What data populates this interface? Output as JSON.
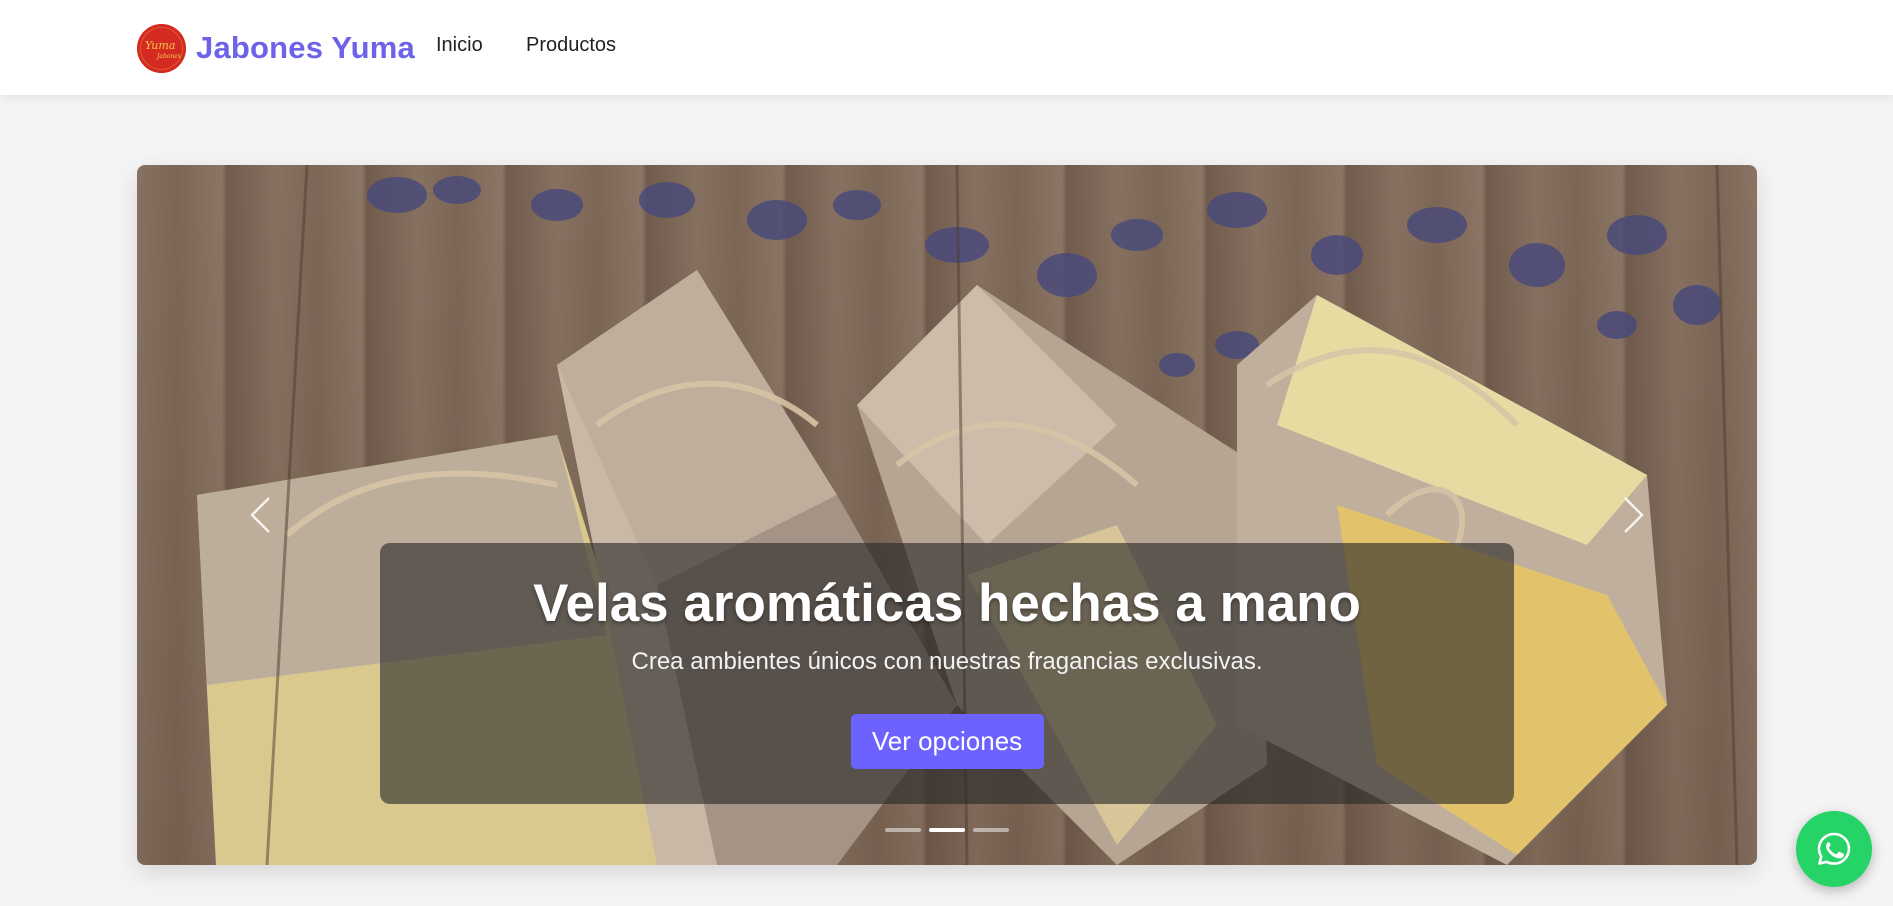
{
  "brand": {
    "name": "Jabones Yuma",
    "logo_text": "Yuma",
    "logo_subtext": "Jabones"
  },
  "nav": {
    "items": [
      {
        "label": "Inicio"
      },
      {
        "label": "Productos"
      }
    ]
  },
  "carousel": {
    "slide": {
      "title": "Velas aromáticas hechas a mano",
      "subtitle": "Crea ambientes únicos con nuestras fragancias exclusivas.",
      "button_label": "Ver opciones"
    },
    "indicator_count": 3,
    "active_indicator": 2,
    "prev_icon": "chevron-left-icon",
    "next_icon": "chevron-right-icon"
  },
  "floating": {
    "whatsapp_icon": "whatsapp-icon"
  },
  "colors": {
    "accent": "#6c63ff",
    "brand_text": "#6c63e8",
    "whatsapp": "#25d366",
    "logo_red": "#d42a22"
  }
}
